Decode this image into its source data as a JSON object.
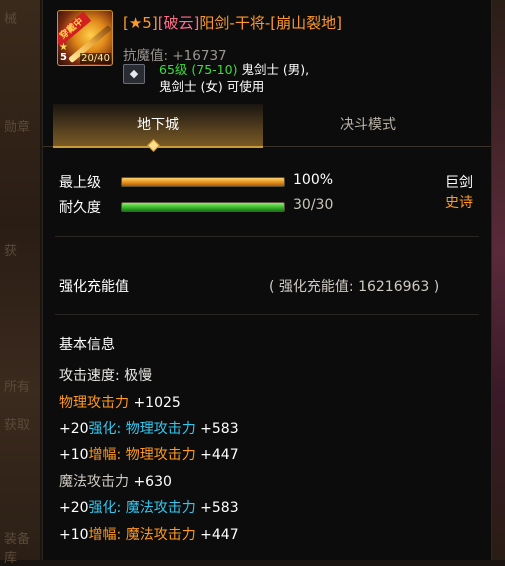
{
  "background": {
    "left_ghost_text": [
      "械",
      "勋章",
      "获",
      "所有",
      "获取",
      "装备库"
    ]
  },
  "item": {
    "icon": {
      "banner": "穿戴中",
      "enhance": "5",
      "counter": "20/40",
      "name": "sword-item-icon"
    },
    "title_prefix": "[★5]",
    "title_tag": "[破云]",
    "title_name": "阳剑-干将-[崩山裂地]",
    "resist_label": "抗魔值:",
    "resist_value": "+16737",
    "req_level": "65级 (75-10)",
    "req_class_1": "鬼剑士 (男),",
    "req_class_2": "鬼剑士 (女) 可使用",
    "gem_icon": "diamond-icon"
  },
  "tabs": [
    {
      "label": "地下城",
      "active": true
    },
    {
      "label": "决斗模式",
      "active": false
    }
  ],
  "stats": {
    "top_label": "最上级",
    "top_percent": "100%",
    "top_fraction": 1.0,
    "dur_label": "耐久度",
    "dur_value": "30/30",
    "dur_fraction": 1.0,
    "weapon_type": "巨剑",
    "rarity": "史诗"
  },
  "enhance": {
    "label": "强化充能值",
    "value_text": "( 强化充能值: 16216963 )"
  },
  "basic": {
    "heading": "基本信息",
    "attack_speed_label": "攻击速度:",
    "attack_speed_value": "极慢",
    "phys_label": "物理攻击力",
    "phys_value": "+1025",
    "phys_enh_plus": "+20",
    "phys_enh_word": "强化:",
    "phys_enh_label": "物理攻击力",
    "phys_enh_value": "+583",
    "phys_amp_plus": "+10",
    "phys_amp_word": "增幅:",
    "phys_amp_label": "物理攻击力",
    "phys_amp_value": "+447",
    "mag_label": "魔法攻击力",
    "mag_value": "+630",
    "mag_enh_plus": "+20",
    "mag_enh_word": "强化:",
    "mag_enh_label": "魔法攻击力",
    "mag_enh_value": "+583",
    "mag_amp_plus": "+10",
    "mag_amp_word": "增幅:",
    "mag_amp_label": "魔法攻击力",
    "mag_amp_value": "+447"
  },
  "colors": {
    "orange": "#ff9a1e",
    "cyan": "#33c8f0",
    "green": "#3fdc3f",
    "pink": "#ff6f8a",
    "gold": "#c99a3a"
  }
}
